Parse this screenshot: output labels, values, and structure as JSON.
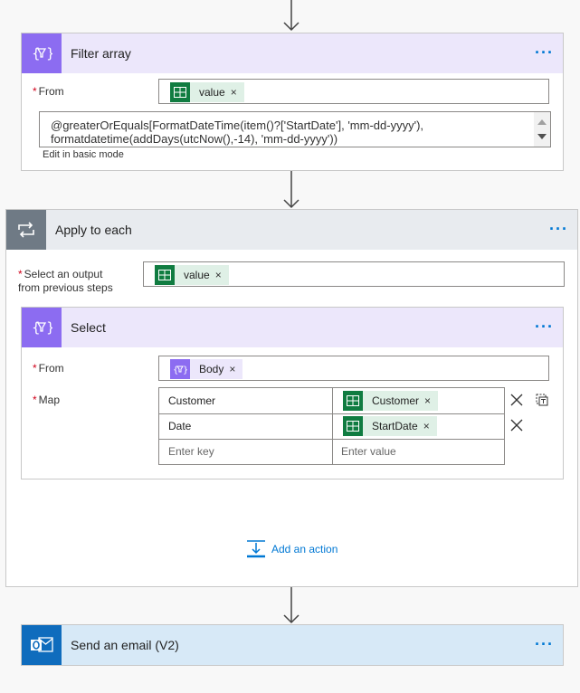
{
  "filter_array": {
    "title": "Filter array",
    "from_label": "From",
    "from_token": "value",
    "expression_line1": "@greaterOrEquals[FormatDateTime(item()?['StartDate'], 'mm-dd-yyyy'),",
    "expression_line2": "formatdatetime(addDays(utcNow(),-14), 'mm-dd-yyyy'))",
    "edit_mode_link": "Edit in basic mode"
  },
  "apply_to_each": {
    "title": "Apply to each",
    "output_label_line1": "Select an output",
    "output_label_line2": "from previous steps",
    "output_token": "value"
  },
  "select": {
    "title": "Select",
    "from_label": "From",
    "from_token": "Body",
    "map_label": "Map",
    "rows": [
      {
        "key": "Customer",
        "value_token": "Customer"
      },
      {
        "key": "Date",
        "value_token": "StartDate"
      }
    ],
    "key_placeholder": "Enter key",
    "value_placeholder": "Enter value"
  },
  "add_action_label": "Add an action",
  "send_email": {
    "title": "Send an email (V2)"
  },
  "menu_dots": "···",
  "token_remove": "×",
  "required_mark": "*",
  "colors": {
    "accent": "#0078d4",
    "excel_green": "#107c41",
    "data_operation_purple": "#8c6cf1",
    "control_gray": "#6f7a85",
    "outlook_blue": "#0f6cbd"
  },
  "icons": {
    "filter_array": "data-operation-icon",
    "apply_to_each": "loop-icon",
    "select": "data-operation-icon",
    "token": "excel-icon",
    "send_email": "outlook-icon",
    "add_action": "add-action-icon"
  }
}
